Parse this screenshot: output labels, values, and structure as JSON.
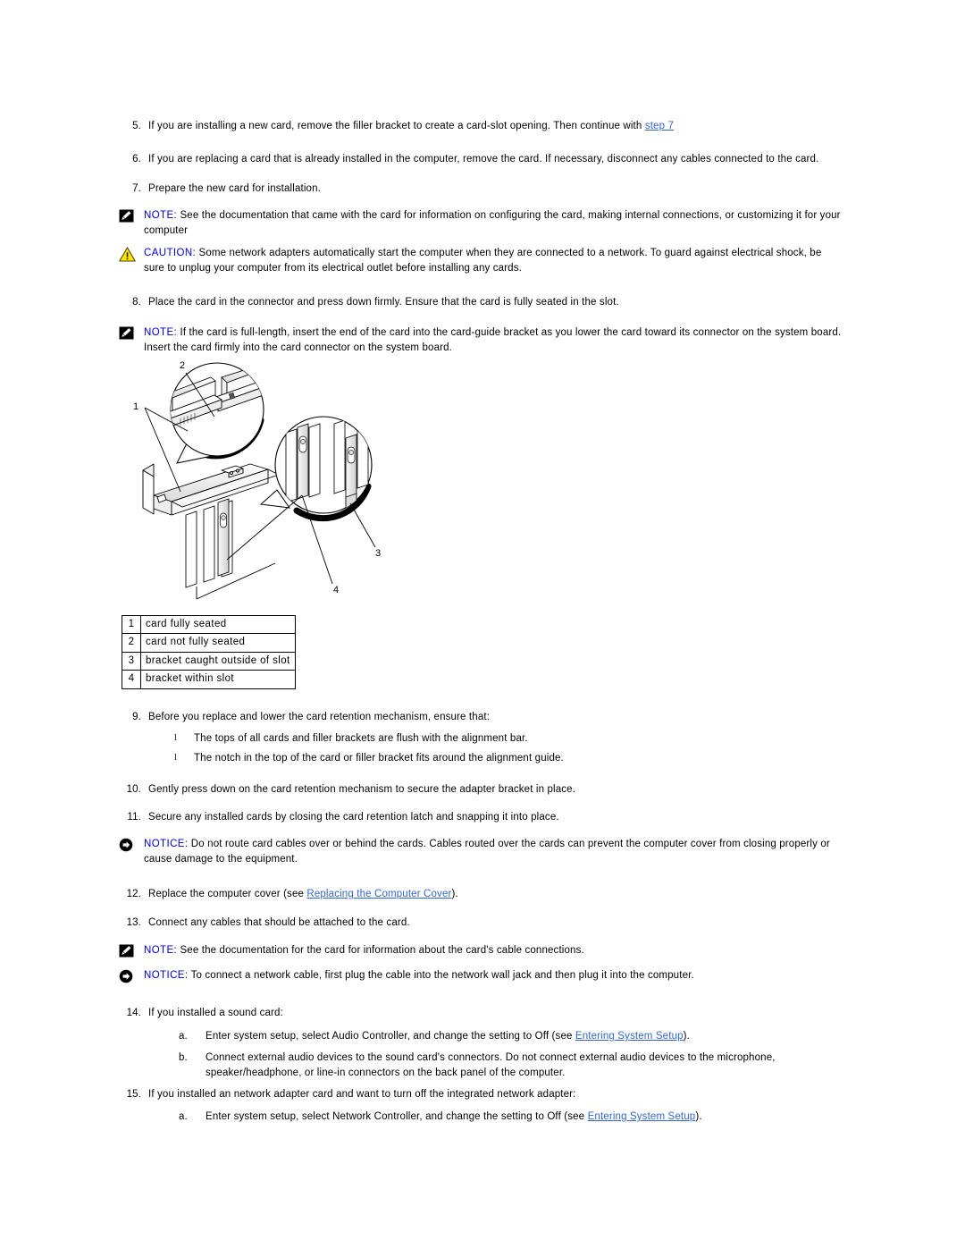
{
  "document": {
    "title": "Installing cards — procedure steps"
  },
  "steps": {
    "s5": {
      "num": "5.",
      "text_before": "If you are installing a new card, remove the filler bracket to create a card-slot opening. Then continue with ",
      "link": "step 7",
      "text_after": ""
    },
    "s6": {
      "num": "6.",
      "text": "If you are replacing a card that is already installed in the computer, remove the card. If necessary, disconnect any cables connected to the card."
    },
    "s7": {
      "num": "7.",
      "text": "Prepare the new card for installation."
    },
    "s8": {
      "num": "8.",
      "text": "Place the card in the connector and press down firmly. Ensure that the card is fully seated in the slot."
    },
    "s9": {
      "num": "9.",
      "text": "Before you replace and lower the card retention mechanism, ensure that:",
      "bullets": [
        "The tops of all cards and filler brackets are flush with the alignment bar.",
        "The notch in the top of the card or filler bracket fits around the alignment guide."
      ],
      "bullet_glyph": "l"
    },
    "s10": {
      "num": "10.",
      "text": "Gently press down on the card retention mechanism to secure the adapter bracket in place."
    },
    "s11": {
      "num": "11.",
      "text": "Secure any installed cards by closing the card retention latch and snapping it into place."
    },
    "s12": {
      "num": "12.",
      "text_before": "Replace the computer cover (see ",
      "link": "Replacing the Computer Cover",
      "text_after": ")."
    },
    "s13": {
      "num": "13.",
      "text": "Connect any cables that should be attached to the card."
    },
    "s14": {
      "num": "14.",
      "text": "If you installed a sound card:",
      "a": {
        "ltr": "a.",
        "text_before": "Enter system setup, select Audio Controller, and change the setting to Off (see ",
        "link": "Entering System Setup",
        "text_after": ")."
      },
      "b": {
        "ltr": "b.",
        "text": "Connect external audio devices to the sound card's connectors. Do not connect external audio devices to the microphone, speaker/headphone, or line-in connectors on the back panel of the computer."
      }
    },
    "s15": {
      "num": "15.",
      "text": "If you installed an network adapter card and want to turn off the integrated network adapter:",
      "a": {
        "ltr": "a.",
        "text_before": "Enter system setup, select Network Controller, and change the setting to Off (see ",
        "link": "Entering System Setup",
        "text_after": ")."
      }
    }
  },
  "admonitions": {
    "note1": {
      "icon": "note-pencil-icon",
      "label": "NOTE:",
      "text": " See the documentation that came with the card for information on configuring the card, making internal connections, or customizing it for your computer"
    },
    "caution1": {
      "icon": "caution-triangle-icon",
      "label": "CAUTION:",
      "text": " Some network adapters automatically start the computer when they are connected to a network. To guard against electrical shock, be sure to unplug your computer from its electrical outlet before installing any cards."
    },
    "note2": {
      "icon": "note-pencil-icon",
      "label": "NOTE:",
      "text": " If the card is full-length, insert the end of the card into the card-guide bracket as you lower the card toward its connector on the system board. Insert the card firmly into the card connector on the system board."
    },
    "notice1": {
      "icon": "notice-circle-arrow-icon",
      "label": "NOTICE:",
      "text": " Do not route card cables over or behind the cards. Cables routed over the cards can prevent the computer cover from closing properly or cause damage to the equipment."
    },
    "note3": {
      "icon": "note-pencil-icon",
      "label": "NOTE:",
      "text": " See the documentation for the card for information about the card's cable connections."
    },
    "notice2": {
      "icon": "notice-circle-arrow-icon",
      "label": "NOTICE:",
      "text": " To connect a network cable, first plug the cable into the network wall jack and then plug it into the computer."
    }
  },
  "illustration": {
    "name": "card-seating-diagram",
    "callouts": [
      "1",
      "2",
      "3",
      "4"
    ]
  },
  "legend": {
    "rows": [
      {
        "n": "1",
        "label": "card fully seated"
      },
      {
        "n": "2",
        "label": "card not fully seated"
      },
      {
        "n": "3",
        "label": "bracket caught outside of slot"
      },
      {
        "n": "4",
        "label": "bracket within slot"
      }
    ]
  },
  "colors": {
    "link": "#3366cc",
    "admonition_label": "#0000cc",
    "caution_fill": "#ffe600",
    "body_text": "#000000"
  }
}
